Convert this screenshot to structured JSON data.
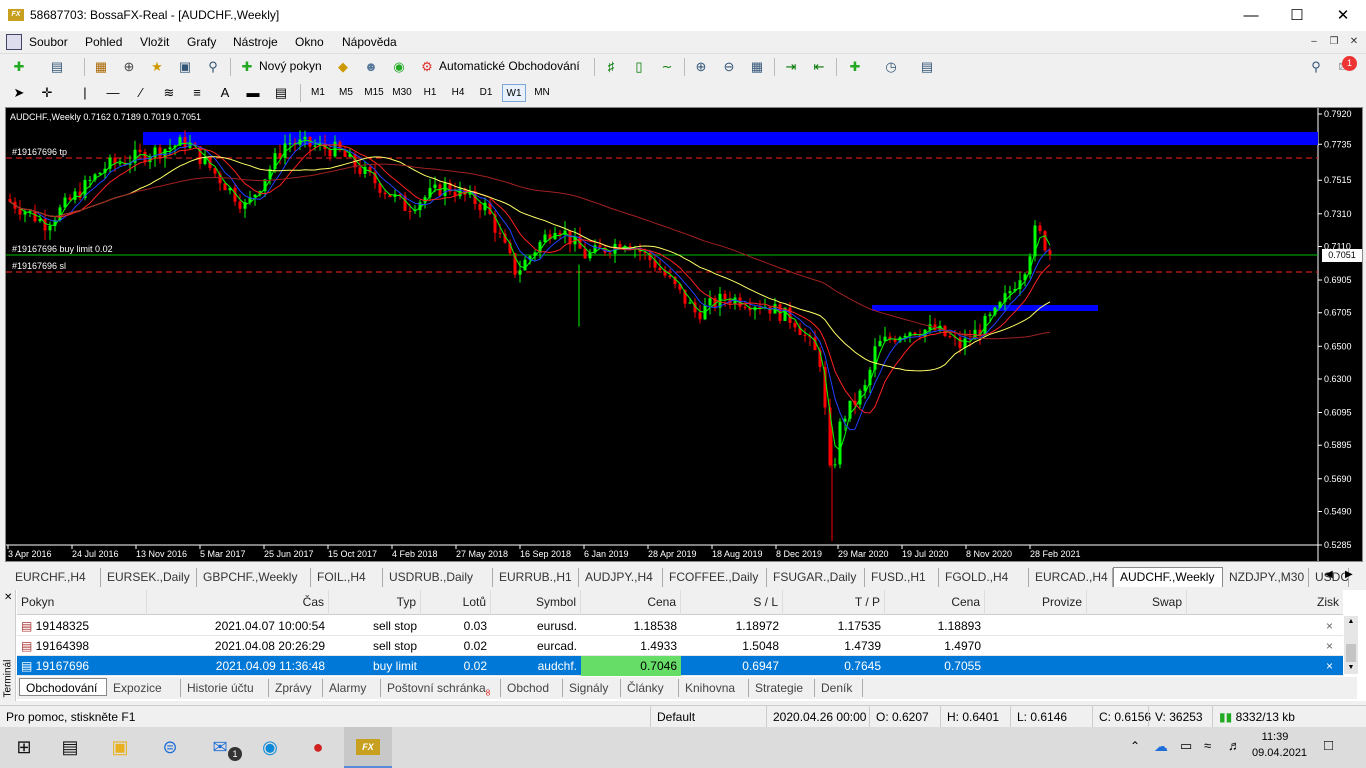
{
  "window": {
    "title": "58687703: BossaFX-Real - [AUDCHF.,Weekly]",
    "logo": "FX"
  },
  "menu": [
    "Soubor",
    "Pohled",
    "Vložit",
    "Grafy",
    "Nástroje",
    "Okno",
    "Nápověda"
  ],
  "toolbar": {
    "new_order": "Nový pokyn",
    "auto_trading": "Automatické Obchodování",
    "notifications": "1"
  },
  "timeframes": [
    "M1",
    "M5",
    "M15",
    "M30",
    "H1",
    "H4",
    "D1",
    "W1",
    "MN"
  ],
  "active_timeframe": "W1",
  "chart": {
    "header": "AUDCHF.,Weekly  0.7162 0.7189 0.7019 0.7051",
    "current_price": "0.7051",
    "labels": {
      "tp": "#19167696 tp",
      "buy_limit": "#19167696 buy limit 0.02",
      "sl": "#19167696 sl"
    },
    "price_ticks": [
      "0.7920",
      "0.7735",
      "0.7515",
      "0.7310",
      "0.7110",
      "0.6905",
      "0.6705",
      "0.6500",
      "0.6300",
      "0.6095",
      "0.5895",
      "0.5690",
      "0.5490",
      "0.5285"
    ],
    "time_ticks": [
      "3 Apr 2016",
      "24 Jul 2016",
      "13 Nov 2016",
      "5 Mar 2017",
      "25 Jun 2017",
      "15 Oct 2017",
      "4 Feb 2018",
      "27 May 2018",
      "16 Sep 2018",
      "6 Jan 2019",
      "28 Apr 2019",
      "18 Aug 2019",
      "8 Dec 2019",
      "29 Mar 2020",
      "19 Jul 2020",
      "8 Nov 2020",
      "28 Feb 2021"
    ],
    "colors": {
      "up": "#00ff00",
      "down": "#ff0000",
      "zone": "#0000ff",
      "ma_yellow": "#ffff66",
      "ma_red": "#ff2020",
      "ma_blue": "#2040ff",
      "ma_green": "#00ff00"
    }
  },
  "chart_tabs": [
    "EURCHF.,H4",
    "EURSEK.,Daily",
    "GBPCHF.,Weekly",
    "FOIL.,H4",
    "USDRUB.,Daily",
    "EURRUB.,H1",
    "AUDJPY.,H4",
    "FCOFFEE.,Daily",
    "FSUGAR.,Daily",
    "FUSD.,H1",
    "FGOLD.,H4",
    "EURCAD.,H4",
    "AUDCHF.,Weekly",
    "NZDJPY.,M30",
    "USDCI"
  ],
  "active_chart_tab": "AUDCHF.,Weekly",
  "terminal": {
    "side_label": "Terminál",
    "columns": [
      "Pokyn",
      "Čas",
      "Typ",
      "Lotů",
      "Symbol",
      "Cena",
      "S / L",
      "T / P",
      "Cena",
      "Provize",
      "Swap",
      "Zisk"
    ],
    "rows": [
      {
        "ticket": "19148325",
        "time": "2021.04.07 10:00:54",
        "type": "sell stop",
        "lots": "0.03",
        "symbol": "eurusd.",
        "price": "1.18538",
        "sl": "1.18972",
        "tp": "1.17535",
        "cur": "1.18893"
      },
      {
        "ticket": "19164398",
        "time": "2021.04.08 20:26:29",
        "type": "sell stop",
        "lots": "0.02",
        "symbol": "eurcad.",
        "price": "1.4933",
        "sl": "1.5048",
        "tp": "1.4739",
        "cur": "1.4970"
      },
      {
        "ticket": "19167696",
        "time": "2021.04.09 11:36:48",
        "type": "buy limit",
        "lots": "0.02",
        "symbol": "audchf.",
        "price": "0.7046",
        "sl": "0.6947",
        "tp": "0.7645",
        "cur": "0.7055"
      }
    ],
    "tabs": [
      "Obchodování",
      "Expozice",
      "Historie účtu",
      "Zprávy",
      "Alarmy",
      "Poštovní schránka",
      "Obchod",
      "Signály",
      "Články",
      "Knihovna",
      "Strategie",
      "Deník"
    ],
    "mailbox_count": "8"
  },
  "status": {
    "help": "Pro pomoc, stiskněte F1",
    "profile": "Default",
    "datetime": "2020.04.26 00:00",
    "o": "O: 0.6207",
    "h": "H: 0.6401",
    "l": "L: 0.6146",
    "c": "C: 0.6156",
    "v": "V: 36253",
    "traffic": "8332/13 kb"
  },
  "taskbar": {
    "time": "11:39",
    "date": "09.04.2021",
    "mail_badge": "1"
  }
}
